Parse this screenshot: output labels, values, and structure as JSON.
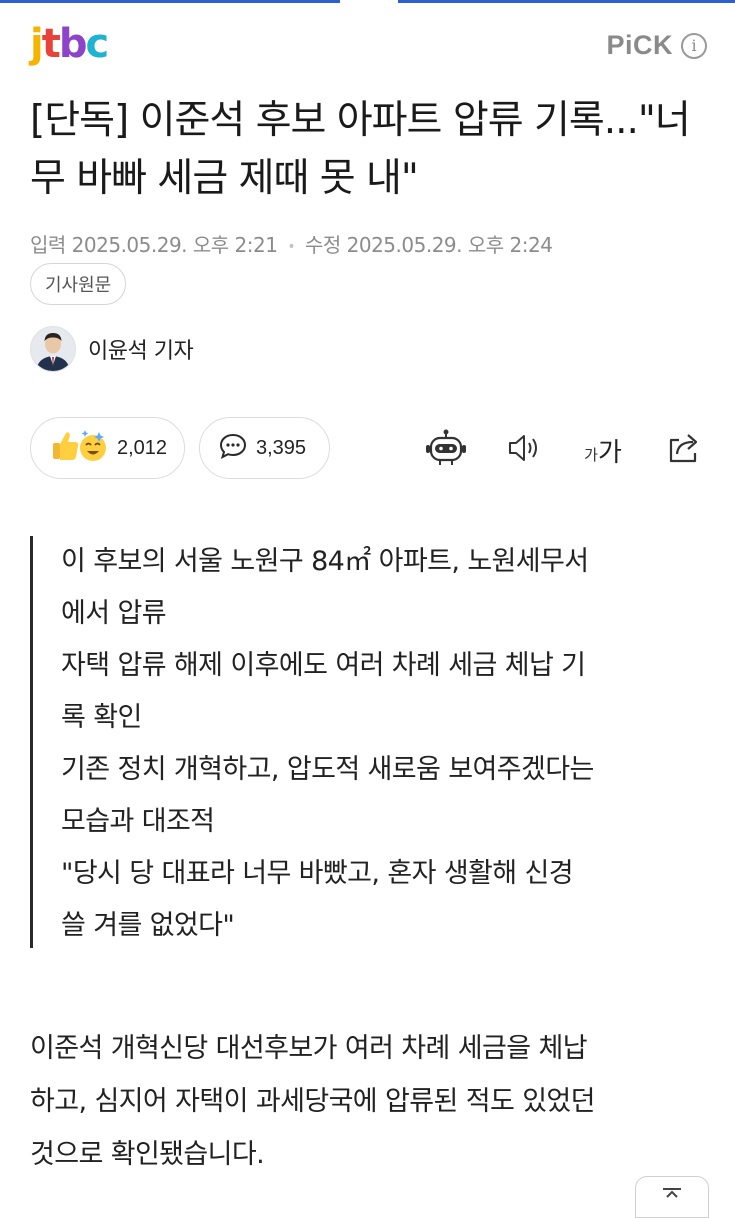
{
  "brand": {
    "logo_text": "jtbc",
    "logo_colors": [
      "#f4b400",
      "#e8433a",
      "#8e44c9",
      "#1fb3d2"
    ],
    "pick_label": "PiCK",
    "info_icon": "info-icon"
  },
  "article": {
    "title": "[단독] 이준석 후보 아파트 압류 기록...\"너무 바빠 세금 제때 못 내\"",
    "input_label": "입력",
    "input_time": "2025.05.29. 오후 2:21",
    "edit_label": "수정",
    "edit_time": "2025.05.29. 오후 2:24",
    "original_button": "기사원문",
    "reporter": "이윤석 기자"
  },
  "reactions": {
    "like_count": "2,012",
    "comment_count": "3,395",
    "like_icon": "reaction-emoji-icon",
    "comment_icon": "comment-icon"
  },
  "toolbar": {
    "ai_icon": "robot-summary-icon",
    "speaker_icon": "speaker-icon",
    "font_small": "가",
    "font_large": "가",
    "share_icon": "share-icon"
  },
  "summary": {
    "lines": [
      "이 후보의 서울 노원구 84㎡ 아파트, 노원세무서",
      "에서 압류",
      "자택 압류 해제 이후에도 여러 차례 세금 체납 기",
      "록 확인",
      "기존 정치 개혁하고, 압도적 새로움 보여주겠다는",
      "모습과 대조적",
      "\"당시 당 대표라 너무 바빴고, 혼자 생활해 신경",
      "쓸 겨를 없었다\""
    ]
  },
  "body": {
    "lines": [
      "이준석 개혁신당 대선후보가 여러 차례 세금을 체납",
      "하고, 심지어 자택이 과세당국에 압류된 적도 있었던",
      "것으로 확인됐습니다."
    ]
  }
}
